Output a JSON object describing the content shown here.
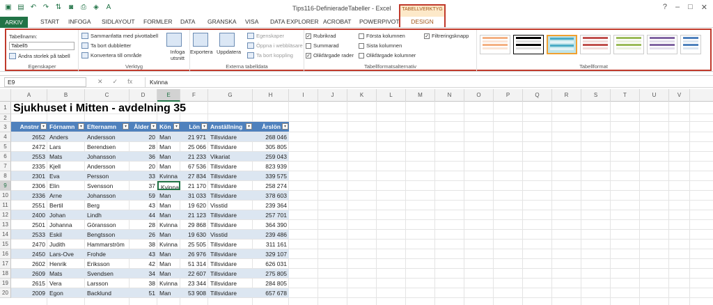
{
  "window": {
    "title": "Tips116-DefinieradeTabeller - Excel"
  },
  "tabs": [
    "ARKIV",
    "START",
    "INFOGA",
    "SIDLAYOUT",
    "FORMLER",
    "DATA",
    "GRANSKA",
    "VISA",
    "DATA EXPLORER",
    "ACROBAT",
    "POWERPIVOT"
  ],
  "context_tab": {
    "group": "TABELLVERKTYG",
    "tab": "DESIGN"
  },
  "ribbon": {
    "egenskaper": {
      "title": "Egenskaper",
      "name_label": "Tabellnamn:",
      "name_value": "Tabell5",
      "resize": "Ändra storlek på tabell"
    },
    "verktyg": {
      "title": "Verktyg",
      "summarize": "Sammanfatta med pivottabell",
      "remove_dup": "Ta bort dubbletter",
      "convert": "Konvertera till område",
      "insert_slicer": "Infoga utsnitt"
    },
    "extern": {
      "title": "Externa tabelldata",
      "export": "Exportera",
      "refresh": "Uppdatera",
      "props": "Egenskaper",
      "open_browser": "Öppna i webbläsare",
      "unlink": "Ta bort koppling"
    },
    "options": {
      "title": "Tabellformatsalternativ",
      "items": [
        {
          "label": "Rubrikrad",
          "checked": true
        },
        {
          "label": "Summarad",
          "checked": false
        },
        {
          "label": "Olikfärgade rader",
          "checked": true
        },
        {
          "label": "Första kolumnen",
          "checked": false
        },
        {
          "label": "Sista kolumnen",
          "checked": false
        },
        {
          "label": "Olikfärgade kolumner",
          "checked": false
        },
        {
          "label": "Filtreringsknapp",
          "checked": true
        }
      ]
    },
    "styles": {
      "title": "Tabellformat"
    }
  },
  "formula_bar": {
    "cell_ref": "E9",
    "value": "Kvinna"
  },
  "columns": [
    "A",
    "B",
    "C",
    "D",
    "E",
    "F",
    "G",
    "H",
    "I",
    "J",
    "K",
    "L",
    "M",
    "N",
    "O",
    "P",
    "Q",
    "R",
    "S",
    "T",
    "U",
    "V"
  ],
  "rows": [
    "1",
    "2",
    "3",
    "4",
    "5",
    "6",
    "7",
    "8",
    "9",
    "10",
    "11",
    "12",
    "13",
    "14",
    "15",
    "16",
    "17",
    "18",
    "19",
    "20"
  ],
  "sheet": {
    "title": "Sjukhuset i Mitten - avdelning 35",
    "headers": [
      "Anstnr",
      "Förnamn",
      "Efternamn",
      "Ålder",
      "Kön",
      "Lön",
      "Anställning",
      "Årslön"
    ],
    "data": [
      [
        "2652",
        "Anders",
        "Andersson",
        "20",
        "Man",
        "21 971",
        "Tillsvidare",
        "268 046"
      ],
      [
        "2472",
        "Lars",
        "Berendsen",
        "28",
        "Man",
        "25 066",
        "Tillsvidare",
        "305 805"
      ],
      [
        "2553",
        "Mats",
        "Johansson",
        "36",
        "Man",
        "21 233",
        "Vikariat",
        "259 043"
      ],
      [
        "2335",
        "Kjell",
        "Andersson",
        "20",
        "Man",
        "67 536",
        "Tillsvidare",
        "823 939"
      ],
      [
        "2301",
        "Eva",
        "Persson",
        "33",
        "Kvinna",
        "27 834",
        "Tillsvidare",
        "339 575"
      ],
      [
        "2306",
        "Elin",
        "Svensson",
        "37",
        "Kvinna",
        "21 170",
        "Tillsvidare",
        "258 274"
      ],
      [
        "2336",
        "Arne",
        "Johansson",
        "59",
        "Man",
        "31 033",
        "Tillsvidare",
        "378 603"
      ],
      [
        "2551",
        "Bertil",
        "Berg",
        "43",
        "Man",
        "19 620",
        "Visstid",
        "239 364"
      ],
      [
        "2400",
        "Johan",
        "Lindh",
        "44",
        "Man",
        "21 123",
        "Tillsvidare",
        "257 701"
      ],
      [
        "2501",
        "Johanna",
        "Göransson",
        "28",
        "Kvinna",
        "29 868",
        "Tillsvidare",
        "364 390"
      ],
      [
        "2533",
        "Eskil",
        "Bengtsson",
        "26",
        "Man",
        "19 630",
        "Visstid",
        "239 486"
      ],
      [
        "2470",
        "Judith",
        "Hammarström",
        "38",
        "Kvinna",
        "25 505",
        "Tillsvidare",
        "311 161"
      ],
      [
        "2450",
        "Lars-Ove",
        "Frohde",
        "43",
        "Man",
        "26 976",
        "Tillsvidare",
        "329 107"
      ],
      [
        "2602",
        "Henrik",
        "Eriksson",
        "42",
        "Man",
        "51 314",
        "Tillsvidare",
        "626 031"
      ],
      [
        "2609",
        "Mats",
        "Svendsen",
        "34",
        "Man",
        "22 607",
        "Tillsvidare",
        "275 805"
      ],
      [
        "2615",
        "Vera",
        "Larsson",
        "38",
        "Kvinna",
        "23 344",
        "Tillsvidare",
        "284 805"
      ],
      [
        "2009",
        "Egon",
        "Backlund",
        "51",
        "Man",
        "53 908",
        "Tillsvidare",
        "657 678"
      ]
    ]
  },
  "colors": {
    "excel_green": "#217346",
    "table_header": "#4f81bd",
    "band": "#dce6f1",
    "highlight": "#c0392b"
  }
}
